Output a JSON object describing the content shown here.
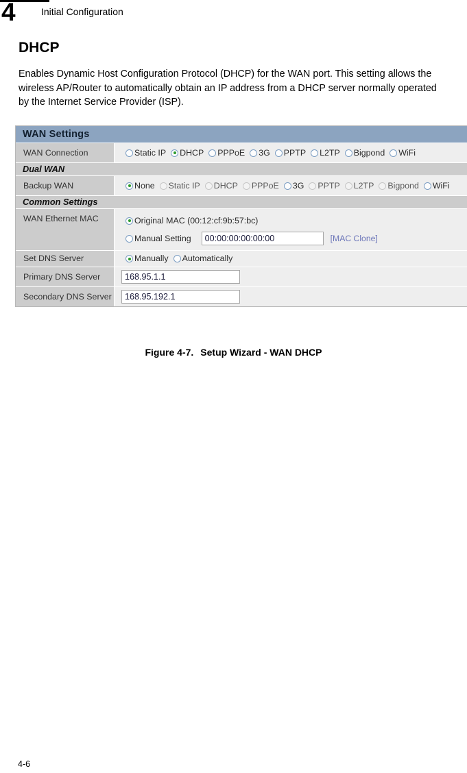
{
  "page": {
    "chapter_number": "4",
    "chapter_title": "Initial Configuration",
    "section_heading": "DHCP",
    "body_paragraph": "Enables Dynamic Host Configuration Protocol (DHCP) for the WAN port. This setting allows the wireless AP/Router to automatically obtain an IP address from a DHCP server normally operated by the Internet Service Provider (ISP).",
    "figure_caption_label": "Figure 4-7.",
    "figure_caption_text": "Setup Wizard - WAN DHCP",
    "footer_page_number": "4-6"
  },
  "colors": {
    "panel_title_bg": "#8ca4c0",
    "section_bar_bg": "#cccccc",
    "row_label_bg": "#cccccc",
    "row_value_bg": "#eeeeee",
    "radio_selected_dot": "#2c9b2c",
    "radio_outline": "#7d9fc4",
    "link": "#6a74b8"
  },
  "panel": {
    "title": "WAN Settings",
    "sections": {
      "dual_wan": "Dual WAN",
      "common_settings": "Common Settings"
    },
    "rows": {
      "wan_connection": {
        "label": "WAN Connection",
        "options": [
          {
            "label": "Static IP",
            "selected": false,
            "disabled": false
          },
          {
            "label": "DHCP",
            "selected": true,
            "disabled": false
          },
          {
            "label": "PPPoE",
            "selected": false,
            "disabled": false
          },
          {
            "label": "3G",
            "selected": false,
            "disabled": false
          },
          {
            "label": "PPTP",
            "selected": false,
            "disabled": false
          },
          {
            "label": "L2TP",
            "selected": false,
            "disabled": false
          },
          {
            "label": "Bigpond",
            "selected": false,
            "disabled": false
          },
          {
            "label": "WiFi",
            "selected": false,
            "disabled": false
          }
        ]
      },
      "backup_wan": {
        "label": "Backup WAN",
        "options": [
          {
            "label": "None",
            "selected": true,
            "disabled": false
          },
          {
            "label": "Static IP",
            "selected": false,
            "disabled": true
          },
          {
            "label": "DHCP",
            "selected": false,
            "disabled": true
          },
          {
            "label": "PPPoE",
            "selected": false,
            "disabled": true
          },
          {
            "label": "3G",
            "selected": false,
            "disabled": false
          },
          {
            "label": "PPTP",
            "selected": false,
            "disabled": true
          },
          {
            "label": "L2TP",
            "selected": false,
            "disabled": true
          },
          {
            "label": "Bigpond",
            "selected": false,
            "disabled": true
          },
          {
            "label": "WiFi",
            "selected": false,
            "disabled": false
          }
        ]
      },
      "wan_ethernet_mac": {
        "label": "WAN Ethernet MAC",
        "original_option_label": "Original MAC (00:12:cf:9b:57:bc)",
        "original_selected": true,
        "manual_option_label": "Manual Setting",
        "manual_selected": false,
        "manual_value": "00:00:00:00:00:00",
        "mac_clone_link": "[MAC Clone]"
      },
      "set_dns_server": {
        "label": "Set DNS Server",
        "options": [
          {
            "label": "Manually",
            "selected": true,
            "disabled": false
          },
          {
            "label": "Automatically",
            "selected": false,
            "disabled": false
          }
        ]
      },
      "primary_dns": {
        "label": "Primary DNS Server",
        "value": "168.95.1.1"
      },
      "secondary_dns": {
        "label": "Secondary DNS Server",
        "value": "168.95.192.1"
      }
    }
  }
}
